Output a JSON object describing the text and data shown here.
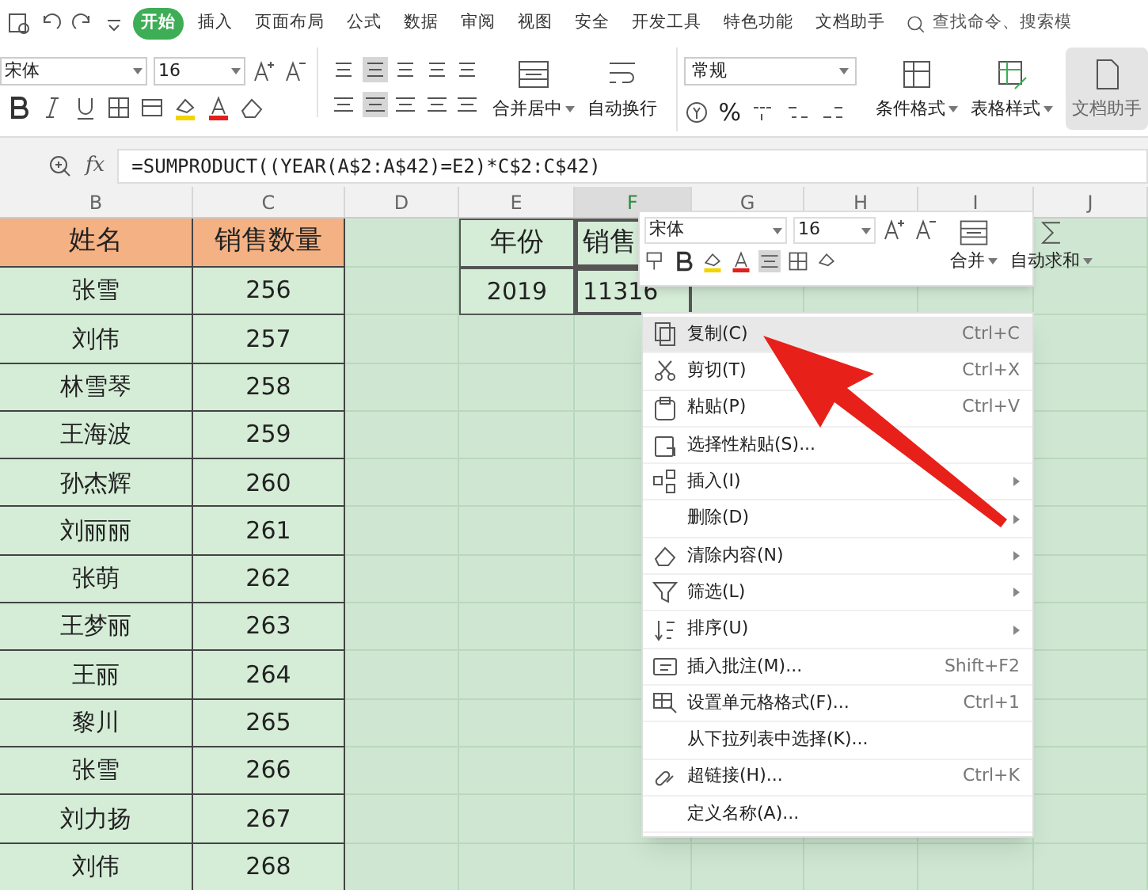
{
  "ribbon": {
    "tabs": [
      {
        "label": "开始",
        "selected": true
      },
      {
        "label": "插入",
        "selected": false
      },
      {
        "label": "页面布局",
        "selected": false
      },
      {
        "label": "公式",
        "selected": false
      },
      {
        "label": "数据",
        "selected": false
      },
      {
        "label": "审阅",
        "selected": false
      },
      {
        "label": "视图",
        "selected": false
      },
      {
        "label": "安全",
        "selected": false
      },
      {
        "label": "开发工具",
        "selected": false
      },
      {
        "label": "特色功能",
        "selected": false
      },
      {
        "label": "文档助手",
        "selected": false
      }
    ],
    "search": {
      "placeholder": "查找命令、搜索模"
    },
    "font": {
      "name": "宋体",
      "size": "16"
    },
    "number_format": "常规",
    "percent": "%",
    "merge_label": "合并居中",
    "wrap_label": "自动换行",
    "conditional_label": "条件格式",
    "table_style_label": "表格样式",
    "assistant_label": "文档助手"
  },
  "formula_bar": {
    "fx": "fx",
    "formula": "=SUMPRODUCT((YEAR(A$2:A$42)=E2)*C$2:C$42)"
  },
  "sheet": {
    "columns": [
      {
        "label": "B",
        "selected": false
      },
      {
        "label": "C",
        "selected": false
      },
      {
        "label": "D",
        "selected": false
      },
      {
        "label": "E",
        "selected": false
      },
      {
        "label": "F",
        "selected": true
      },
      {
        "label": "G",
        "selected": false
      },
      {
        "label": "H",
        "selected": false
      },
      {
        "label": "I",
        "selected": false
      },
      {
        "label": "J",
        "selected": false
      }
    ],
    "headers": [
      "姓名",
      "销售数量"
    ],
    "rows": [
      [
        "张雪",
        "256"
      ],
      [
        "刘伟",
        "257"
      ],
      [
        "林雪琴",
        "258"
      ],
      [
        "王海波",
        "259"
      ],
      [
        "孙杰辉",
        "260"
      ],
      [
        "刘丽丽",
        "261"
      ],
      [
        "张萌",
        "262"
      ],
      [
        "王梦丽",
        "263"
      ],
      [
        "王丽",
        "264"
      ],
      [
        "黎川",
        "265"
      ],
      [
        "张雪",
        "266"
      ],
      [
        "刘力扬",
        "267"
      ],
      [
        "刘伟",
        "268"
      ]
    ],
    "summary_headers": [
      "年份",
      "销售"
    ],
    "summary_values": [
      "2019",
      "11316"
    ]
  },
  "mini_toolbar": {
    "font": "宋体",
    "size": "16",
    "merge": "合并",
    "autosum": "自动求和"
  },
  "context_menu": [
    {
      "label": "复制(C)",
      "shortcut": "Ctrl+C",
      "submenu": false,
      "selected": true
    },
    {
      "label": "剪切(T)",
      "shortcut": "Ctrl+X",
      "submenu": false,
      "selected": false
    },
    {
      "label": "粘贴(P)",
      "shortcut": "Ctrl+V",
      "submenu": false,
      "selected": false
    },
    {
      "label": "选择性粘贴(S)...",
      "submenu": false,
      "selected": false
    },
    {
      "label": "插入(I)",
      "submenu": true,
      "selected": false
    },
    {
      "label": "删除(D)",
      "submenu": true,
      "selected": false
    },
    {
      "label": "清除内容(N)",
      "submenu": true,
      "selected": false
    },
    {
      "label": "筛选(L)",
      "submenu": true,
      "selected": false
    },
    {
      "label": "排序(U)",
      "submenu": true,
      "selected": false
    },
    {
      "label": "插入批注(M)...",
      "shortcut": "Shift+F2",
      "submenu": false,
      "selected": false
    },
    {
      "label": "设置单元格格式(F)...",
      "shortcut": "Ctrl+1",
      "submenu": false,
      "selected": false
    },
    {
      "label": "从下拉列表中选择(K)...",
      "submenu": false,
      "selected": false
    },
    {
      "label": "超链接(H)...",
      "shortcut": "Ctrl+K",
      "submenu": false,
      "selected": false
    },
    {
      "label": "定义名称(A)...",
      "submenu": false,
      "selected": false
    }
  ]
}
